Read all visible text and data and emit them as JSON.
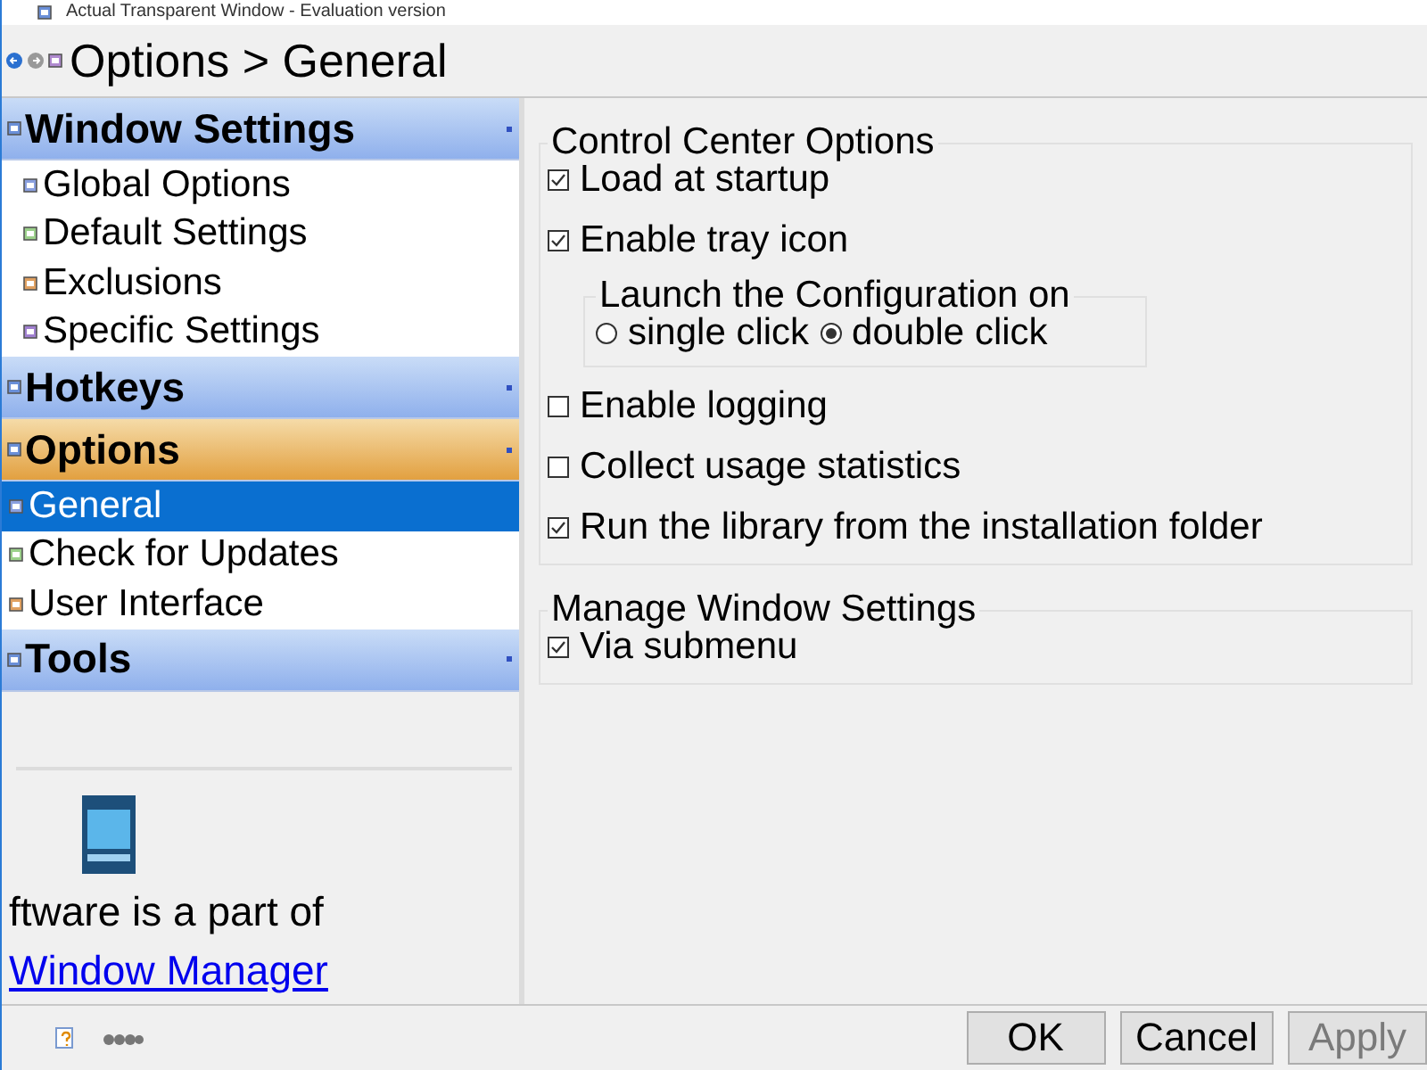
{
  "window": {
    "title": "Actual Transparent Window - Evaluation version"
  },
  "header": {
    "title": "Options > General"
  },
  "sidebar": {
    "sections": [
      {
        "label": "Window Settings",
        "selected": false,
        "items": [
          {
            "label": "Global Options",
            "selected": false
          },
          {
            "label": "Default Settings",
            "selected": false
          },
          {
            "label": "Exclusions",
            "selected": false
          },
          {
            "label": "Specific Settings",
            "selected": false
          }
        ]
      },
      {
        "label": "Hotkeys",
        "selected": false
      },
      {
        "label": "Options",
        "selected": true,
        "items": [
          {
            "label": "General",
            "selected": true
          },
          {
            "label": "Check for Updates",
            "selected": false
          },
          {
            "label": "User Interface",
            "selected": false
          }
        ]
      },
      {
        "label": "Tools",
        "selected": false
      }
    ]
  },
  "promo": {
    "text": "ftware is a part of",
    "link": "Window Manager"
  },
  "groups": [
    {
      "title": "Control Center Options",
      "options": [
        {
          "kind": "checkbox",
          "label": "Load at startup",
          "checked": true
        },
        {
          "kind": "checkbox",
          "label": "Enable tray icon",
          "checked": true
        },
        {
          "kind": "radio_group",
          "title": "Launch the Configuration on",
          "options": [
            {
              "label": "single click",
              "selected": false
            },
            {
              "label": "double click",
              "selected": true
            }
          ]
        },
        {
          "kind": "checkbox",
          "label": "Enable logging",
          "checked": false
        },
        {
          "kind": "checkbox",
          "label": "Collect usage statistics",
          "checked": false
        },
        {
          "kind": "checkbox",
          "label": "Run the library from the installation folder",
          "checked": true
        }
      ]
    },
    {
      "title": "Manage Window Settings",
      "options": [
        {
          "kind": "checkbox",
          "label": "Via submenu",
          "checked": true
        }
      ]
    }
  ],
  "buttons": [
    {
      "label": "OK",
      "disabled": false
    },
    {
      "label": "Cancel",
      "disabled": false
    },
    {
      "label": "Apply",
      "disabled": true
    }
  ]
}
